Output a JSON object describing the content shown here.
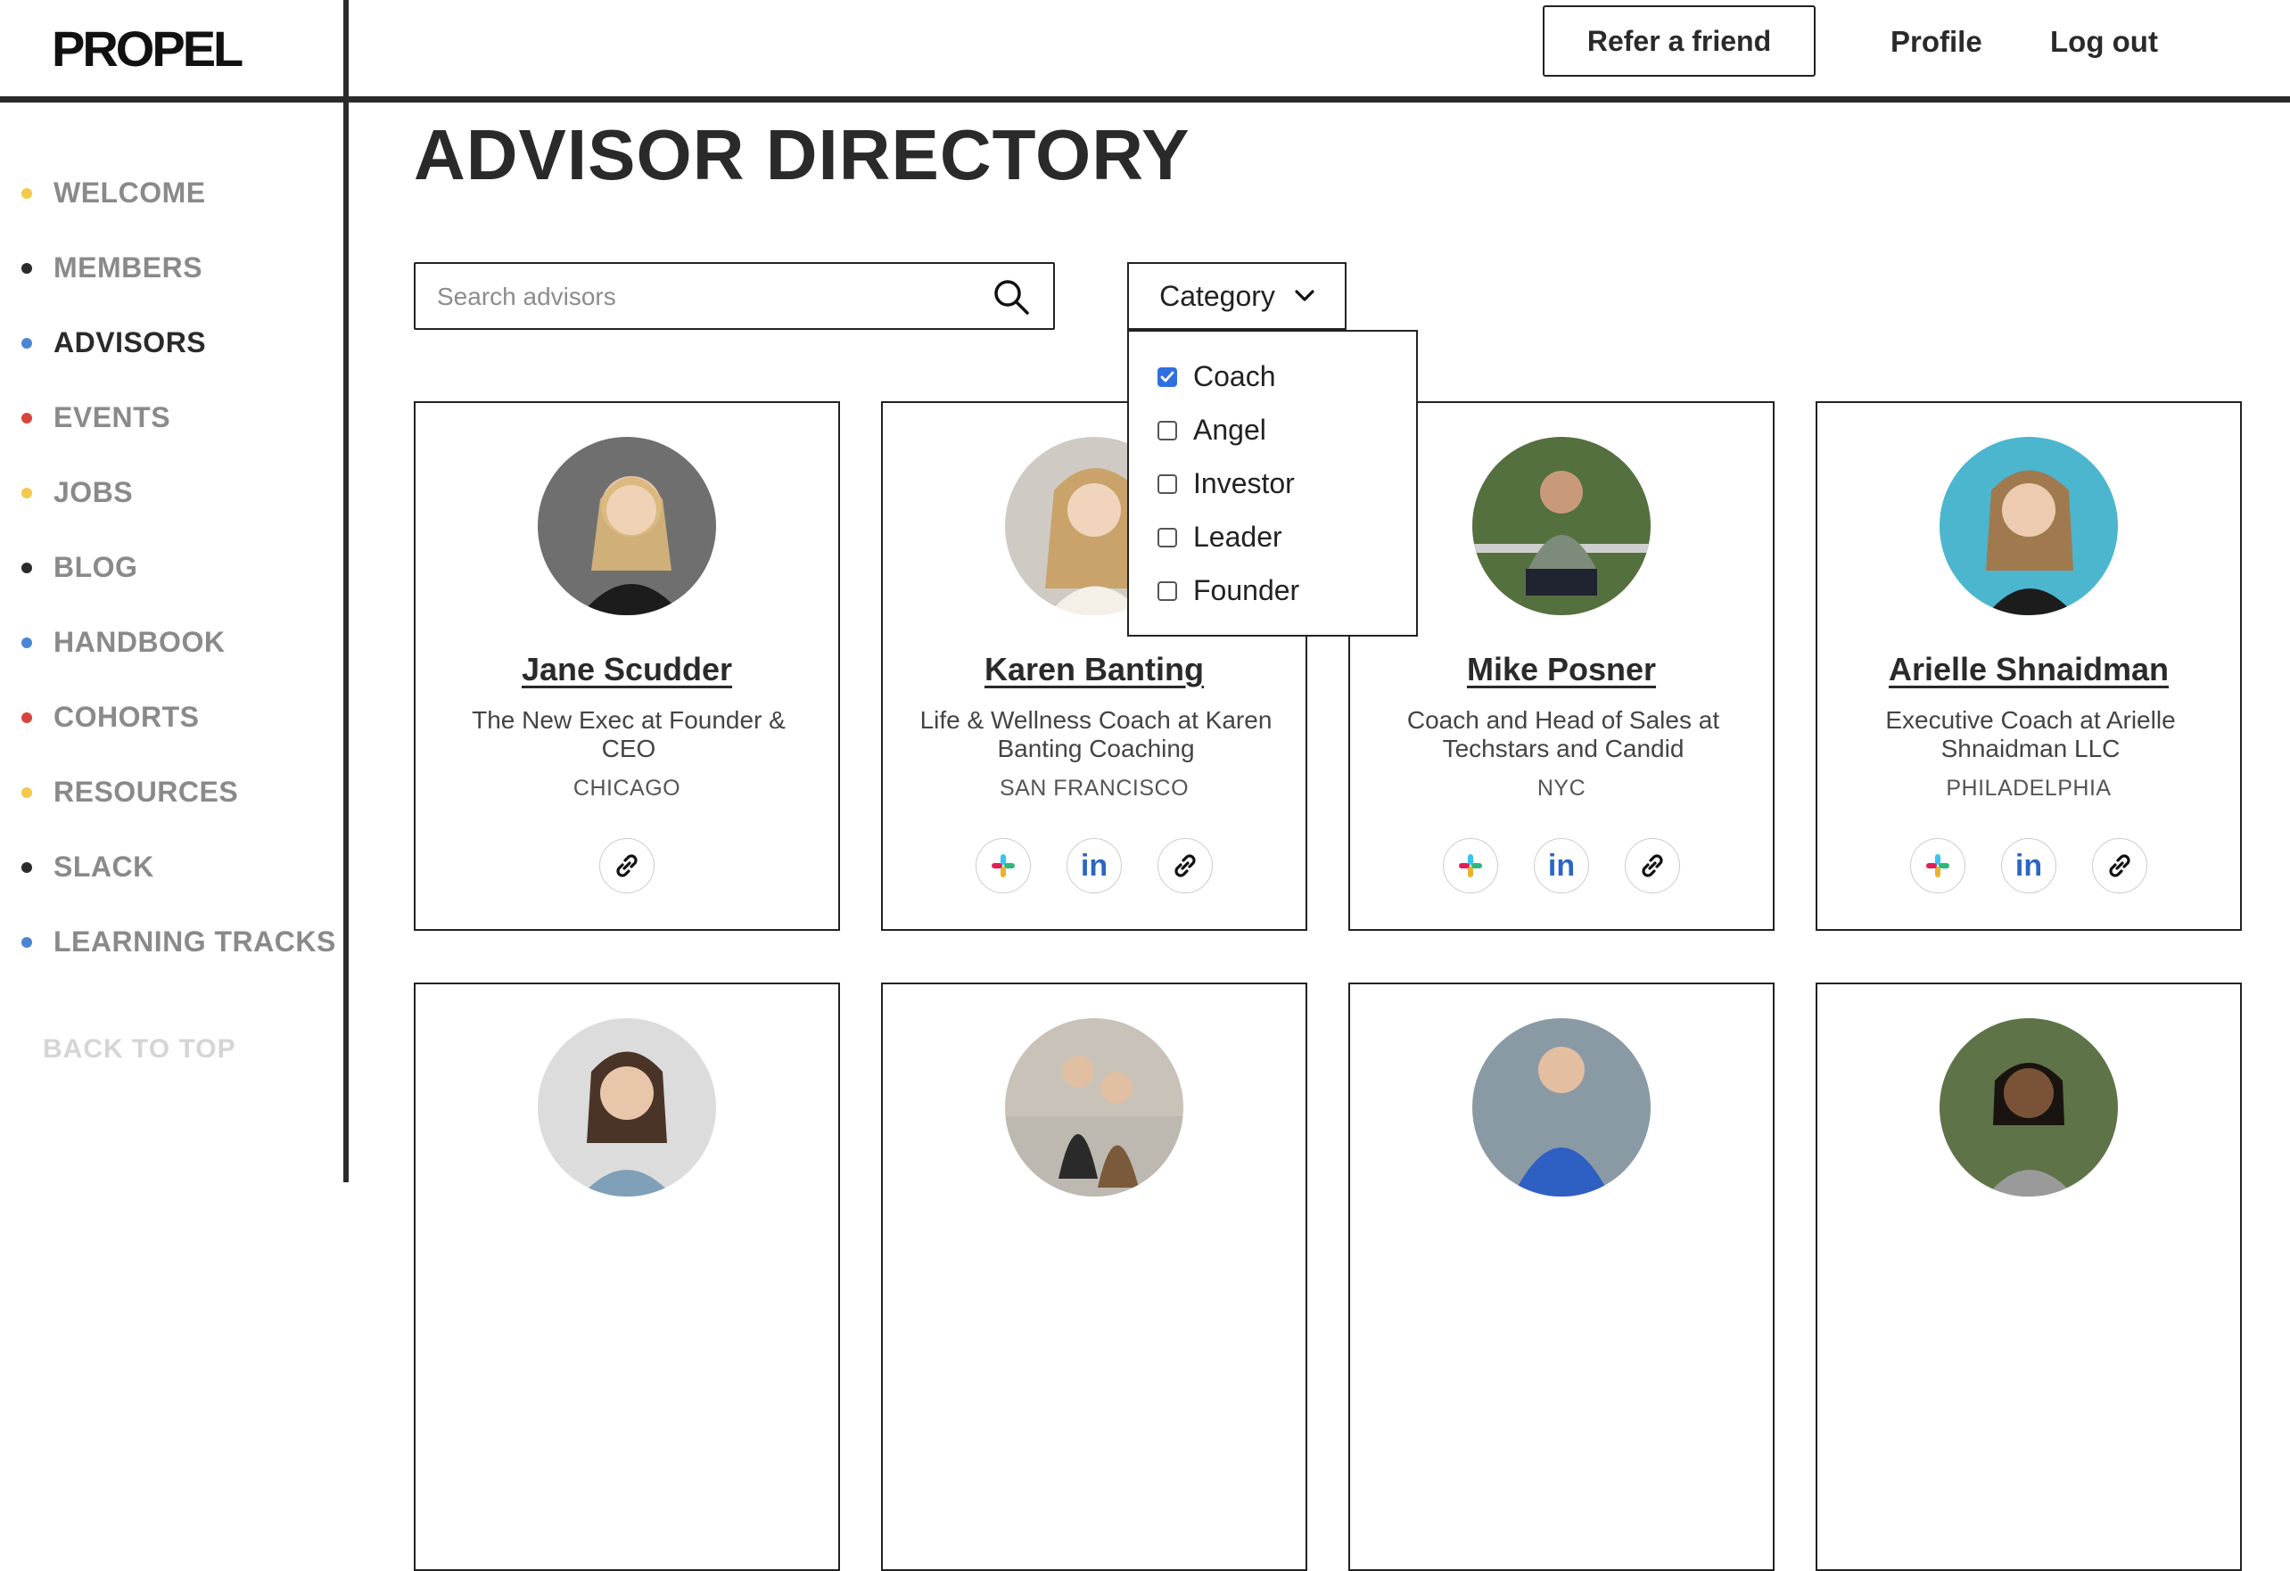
{
  "brand": {
    "logo": "PROPEL"
  },
  "topnav": {
    "refer": "Refer a friend",
    "profile": "Profile",
    "logout": "Log out"
  },
  "sidebar": {
    "items": [
      {
        "label": "WELCOME",
        "color": "#f2c94c"
      },
      {
        "label": "MEMBERS",
        "color": "#2b2b2b"
      },
      {
        "label": "ADVISORS",
        "color": "#4a86d4",
        "active": true
      },
      {
        "label": "EVENTS",
        "color": "#d6453d"
      },
      {
        "label": "JOBS",
        "color": "#f2c94c"
      },
      {
        "label": "BLOG",
        "color": "#2b2b2b"
      },
      {
        "label": "HANDBOOK",
        "color": "#4a86d4"
      },
      {
        "label": "COHORTS",
        "color": "#d6453d"
      },
      {
        "label": "RESOURCES",
        "color": "#f2c94c"
      },
      {
        "label": "SLACK",
        "color": "#2b2b2b"
      },
      {
        "label": "LEARNING TRACKS",
        "color": "#4a86d4"
      }
    ],
    "back_to_top": "BACK TO TOP"
  },
  "page": {
    "title": "ADVISOR DIRECTORY"
  },
  "search": {
    "placeholder": "Search advisors",
    "value": ""
  },
  "category": {
    "label": "Category",
    "options": [
      {
        "label": "Coach",
        "checked": true
      },
      {
        "label": "Angel",
        "checked": false
      },
      {
        "label": "Investor",
        "checked": false
      },
      {
        "label": "Leader",
        "checked": false
      },
      {
        "label": "Founder",
        "checked": false
      }
    ]
  },
  "advisors": [
    {
      "name": "Jane Scudder",
      "role": "The New Exec at Founder & CEO",
      "location": "CHICAGO",
      "icons": [
        "link-icon"
      ],
      "bg": "#6f6f6f"
    },
    {
      "name": "Karen Banting",
      "role": "Life & Wellness Coach at Karen Banting Coaching",
      "location": "SAN FRANCISCO",
      "icons": [
        "slack-icon",
        "linkedin-icon",
        "link-icon"
      ],
      "bg": "#cfcbc4"
    },
    {
      "name": "Mike Posner",
      "role": "Coach and Head of Sales at Techstars and Candid",
      "location": "NYC",
      "icons": [
        "slack-icon",
        "linkedin-icon",
        "link-icon"
      ],
      "bg": "#55703f"
    },
    {
      "name": "Arielle Shnaidman",
      "role": "Executive Coach at Arielle Shnaidman LLC",
      "location": "PHILADELPHIA",
      "icons": [
        "slack-icon",
        "linkedin-icon",
        "link-icon"
      ],
      "bg": "#4cb6cf"
    }
  ],
  "advisors_row2": [
    {
      "bg": "#dcdcdc"
    },
    {
      "bg": "#c9c2b8"
    },
    {
      "bg": "#8a9aa5"
    },
    {
      "bg": "#5f7348"
    }
  ]
}
